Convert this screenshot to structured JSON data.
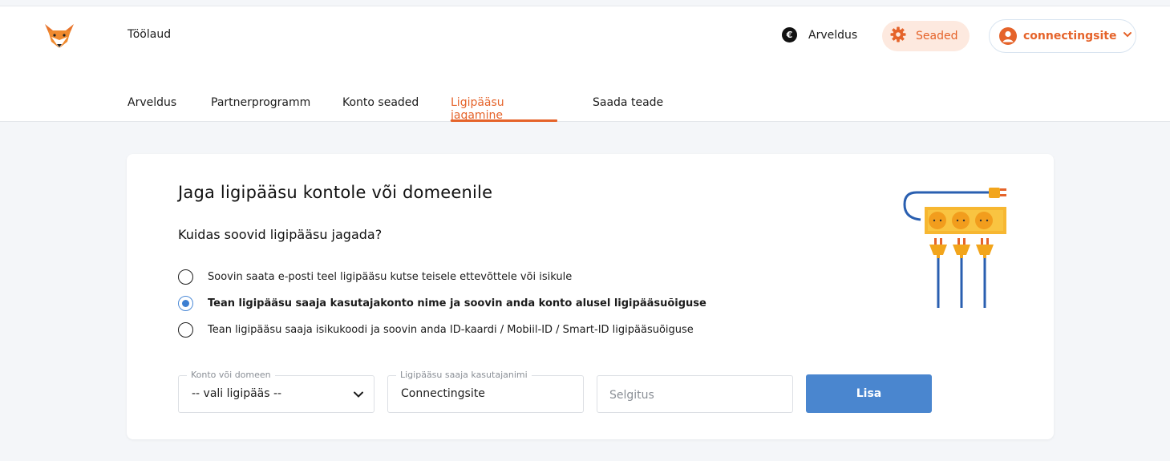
{
  "header": {
    "dashboard_label": "Töölaud",
    "billing_label": "Arveldus",
    "billing_icon": "€",
    "settings_label": "Seaded",
    "username": "connectingsite"
  },
  "tabs": [
    {
      "label": "Arveldus",
      "active": false
    },
    {
      "label": "Partnerprogramm",
      "active": false
    },
    {
      "label": "Konto seaded",
      "active": false
    },
    {
      "label": "Ligipääsu jagamine",
      "active": true
    },
    {
      "label": "Saada teade",
      "active": false
    }
  ],
  "card": {
    "title": "Jaga ligipääsu kontole või domeenile",
    "question": "Kuidas soovid ligipääsu jagada?",
    "options": [
      {
        "label": "Soovin saata e-posti teel ligipääsu kutse teisele ettevõttele või isikule",
        "checked": false
      },
      {
        "label": "Tean ligipääsu saaja kasutajakonto nime ja soovin anda konto alusel ligipääsuõiguse",
        "checked": true
      },
      {
        "label": "Tean ligipääsu saaja isikukoodi ja soovin anda ID-kaardi / Mobiil-ID / Smart-ID ligipääsuõiguse",
        "checked": false
      }
    ],
    "form": {
      "account_label": "Konto või domeen",
      "account_value": "-- vali ligipääs --",
      "username_label": "Ligipääsu saaja kasutajanimi",
      "username_value": "Connectingsite",
      "description_placeholder": "Selgitus",
      "submit_label": "Lisa"
    }
  },
  "colors": {
    "accent": "#e5632a",
    "primary_button": "#4a86cf",
    "page_background": "#f4f6f9"
  }
}
